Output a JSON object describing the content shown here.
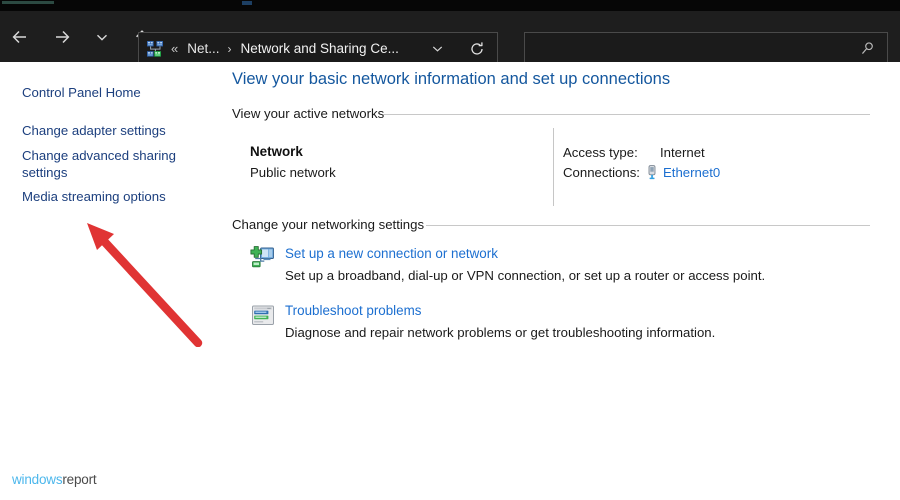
{
  "window": {
    "chrome_bg": "#1e1e1e",
    "content_bg": "#ffffff"
  },
  "navbar": {
    "buttons": [
      {
        "name": "back-button",
        "label": "Back",
        "glyph": "back-arrow-icon"
      },
      {
        "name": "forward-button",
        "label": "Forward",
        "glyph": "forward-arrow-icon"
      },
      {
        "name": "recent-locations-button",
        "label": "Recent locations",
        "glyph": "chevron-down-icon"
      },
      {
        "name": "up-button",
        "label": "Up to Network and Internet",
        "glyph": "up-arrow-icon"
      }
    ],
    "address": {
      "icon": "network-sharing-center-icon",
      "overflow_separator": "«",
      "crumb_truncated": "Net...",
      "crumb_separator": "›",
      "crumb_current": "Network and Sharing Ce...",
      "dropdown_icon": "chevron-down-icon",
      "refresh_icon": "refresh-icon"
    },
    "search": {
      "value": "",
      "placeholder": "",
      "icon": "search-icon"
    }
  },
  "sidebar": {
    "items": [
      {
        "label": "Control Panel Home"
      },
      {
        "label": "Change adapter settings"
      },
      {
        "label": "Change advanced sharing settings"
      },
      {
        "label": "Media streaming options"
      }
    ]
  },
  "main": {
    "page_title": "View your basic network information and set up connections",
    "sections": [
      {
        "heading": "View your active networks"
      },
      {
        "heading": "Change your networking settings"
      }
    ],
    "active_network": {
      "name": "Network",
      "type": "Public network",
      "details": [
        {
          "label": "Access type:",
          "value": "Internet"
        },
        {
          "label": "Connections:",
          "value": "Ethernet0",
          "icon": "ethernet-adapter-icon",
          "is_link": true
        }
      ]
    },
    "tasks": [
      {
        "icon": "new-connection-icon",
        "link": "Set up a new connection or network",
        "description": "Set up a broadband, dial-up or VPN connection, or set up a router or access point."
      },
      {
        "icon": "troubleshoot-icon",
        "link": "Troubleshoot problems",
        "description": "Diagnose and repair network problems or get troubleshooting information."
      }
    ]
  },
  "annotation": {
    "type": "red-arrow",
    "color": "#e03434",
    "points_to": "Change advanced sharing settings"
  },
  "watermark": {
    "part_one": "windows",
    "part_two": "report",
    "color_one": "#4cb7ec",
    "color_two": "#4a4a4a"
  }
}
